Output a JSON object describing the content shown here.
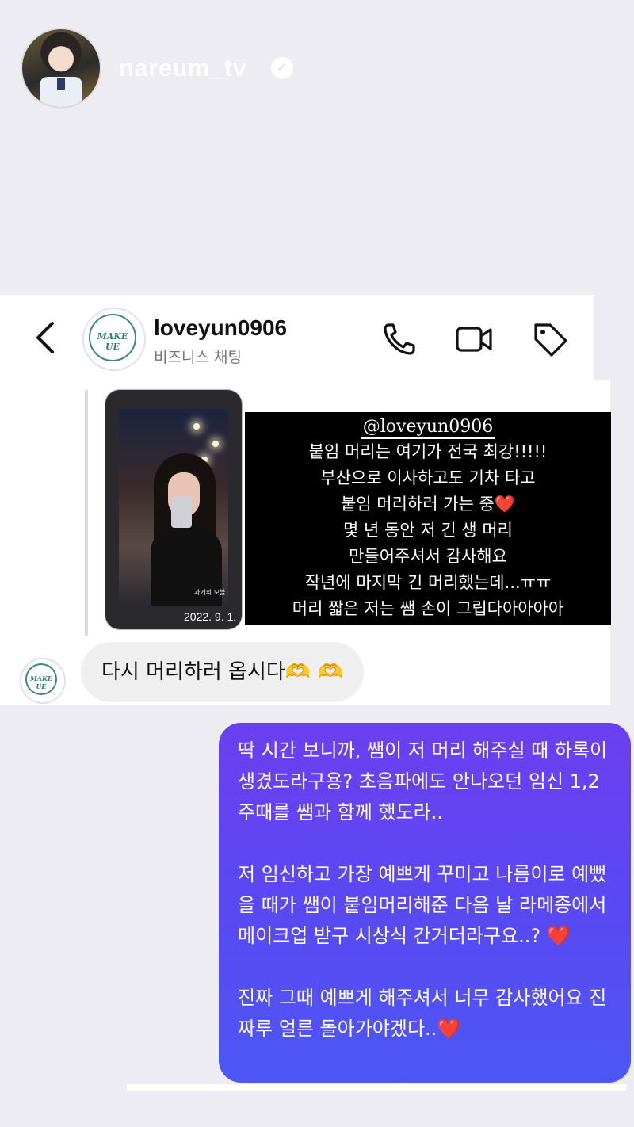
{
  "story": {
    "username": "nareum_tv",
    "verified_icon": "verified-badge-icon"
  },
  "dm": {
    "contact_name": "loveyun0906",
    "contact_subtitle": "비즈니스 채팅",
    "logo_text": "MAKE UE",
    "header_icons": [
      "back-arrow-icon",
      "phone-icon",
      "video-icon",
      "tag-icon"
    ]
  },
  "shared_story": {
    "photo_caption": "과거의 모블",
    "photo_date": "2022. 9. 1.",
    "handle": "@loveyun0906",
    "lines": [
      "붙임 머리는 여기가 전국 최강!!!!!",
      "부산으로 이사하고도 기차 타고",
      "붙임 머리하러 가는 중❤️",
      "몇 년 동안 저 긴 생 머리",
      "만들어주셔서 감사해요",
      "작년에 마지막 긴 머리했는데...ㅠㅠ",
      "머리 짧은 저는 쌤 손이 그립다아아아아"
    ]
  },
  "incoming_message": {
    "text": "다시 머리하러 옵시다🫶 🫶"
  },
  "outgoing_message": {
    "paragraphs": [
      "딱 시간 보니까, 쌤이 저 머리 해주실 때 하록이 생겼도라구용? 초음파에도 안나오던 임신 1,2주때를 쌤과 함께 했도라..",
      "저 임신하고 가장 예쁘게 꾸미고 나름이로 예뻤을 때가 쌤이 붙임머리해준 다음 날 라메종에서 메이크업 받구 시상식 간거더라구요..?",
      "진짜 그때 예쁘게 해주셔서 너무 감사했어요 진짜루 얼른 돌아가야겠다.."
    ],
    "heart": "❤️"
  },
  "colors": {
    "bubble_gradient_top": "#6b3ff0",
    "bubble_gradient_bottom": "#4d57f5",
    "incoming_bubble": "#efefef",
    "page_bg": "#ececf2"
  }
}
